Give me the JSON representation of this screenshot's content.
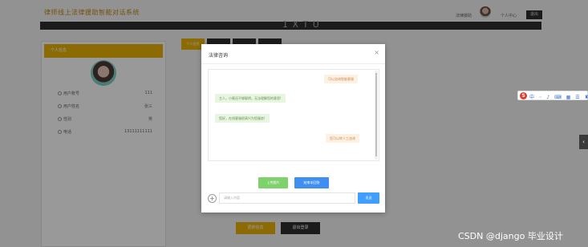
{
  "header": {
    "site_title": "律师线上法律援助智能对话系统",
    "banner_text": "1 X T U",
    "user_label": "法律援助",
    "center_link": "个人中心",
    "logout": "退出"
  },
  "profile": {
    "heading": "个人信息",
    "fields": [
      {
        "key": "用户账号",
        "value": "111"
      },
      {
        "key": "用户姓名",
        "value": "张三"
      },
      {
        "key": "性别",
        "value": "男"
      },
      {
        "key": "电话",
        "value": "13111111111"
      }
    ]
  },
  "tabs": [
    "个人信息",
    "",
    "",
    ""
  ],
  "bottom_buttons": {
    "update": "更新信息",
    "logout": "退出登录"
  },
  "modal": {
    "title": "法律咨询",
    "close": "×",
    "messages": [
      {
        "role": "user",
        "text": "可以咨询智能客服"
      },
      {
        "role": "bot",
        "text": "主人，小蜜还不够聪明，无法理解您的意思!"
      },
      {
        "role": "bot",
        "text": "您好，在线客服很高兴为您服务!"
      },
      {
        "role": "user",
        "text": "您可以转人工咨询"
      }
    ],
    "upload_label": "上传图片",
    "clear_label": "结束本回答",
    "plus": "+",
    "input_placeholder": "请输入内容",
    "send_label": "发送"
  },
  "ime_toolbar": {
    "logo": "S",
    "icons": "中 ◦ ♪ ⌨ ▦ ☰ ♜ ▦ ⋯"
  },
  "side_tab": "‹",
  "watermark": "CSDN @django 毕业设计",
  "colors": {
    "accent": "#e9b308",
    "send_blue": "#409eff",
    "upload_green": "#7dd26c"
  }
}
